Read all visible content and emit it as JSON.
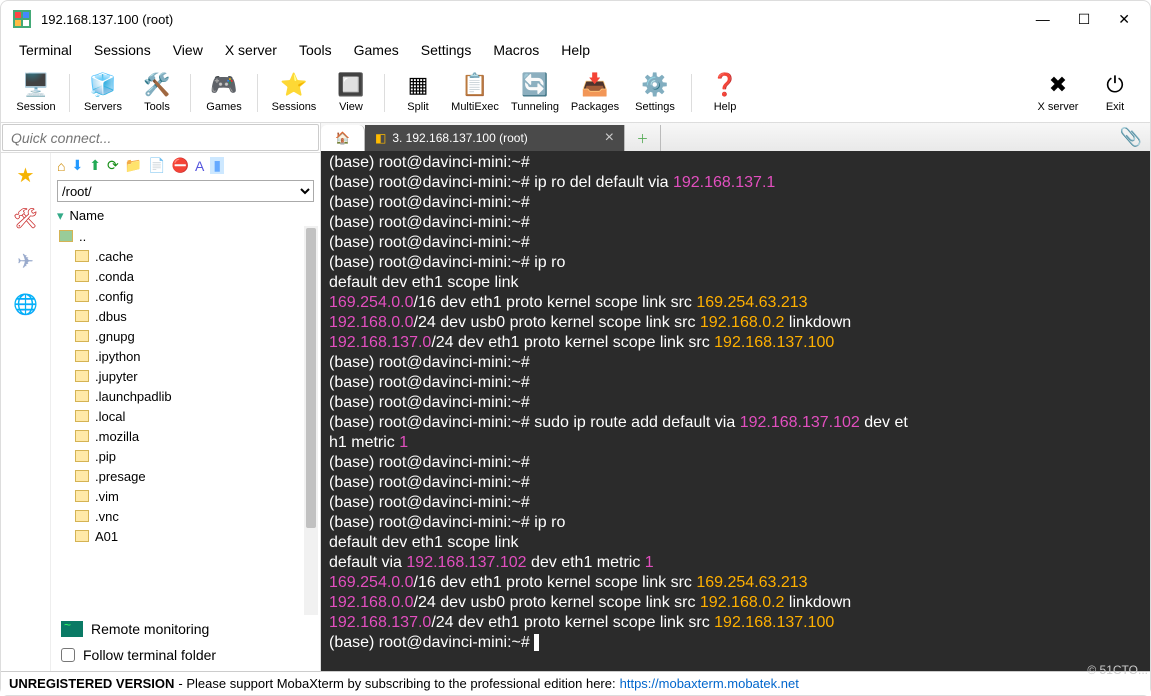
{
  "window": {
    "title": "192.168.137.100 (root)"
  },
  "menu": [
    "Terminal",
    "Sessions",
    "View",
    "X server",
    "Tools",
    "Games",
    "Settings",
    "Macros",
    "Help"
  ],
  "toolbar": [
    {
      "label": "Session",
      "icon": "🖥️"
    },
    {
      "label": "Servers",
      "icon": "🧊"
    },
    {
      "label": "Tools",
      "icon": "🛠️"
    },
    {
      "label": "Games",
      "icon": "🎮"
    },
    {
      "label": "Sessions",
      "icon": "⭐"
    },
    {
      "label": "View",
      "icon": "🔲"
    },
    {
      "label": "Split",
      "icon": "▦"
    },
    {
      "label": "MultiExec",
      "icon": "📋"
    },
    {
      "label": "Tunneling",
      "icon": "🔄"
    },
    {
      "label": "Packages",
      "icon": "📥"
    },
    {
      "label": "Settings",
      "icon": "⚙️"
    },
    {
      "label": "Help",
      "icon": "❓"
    }
  ],
  "toolbar_right": [
    {
      "label": "X server",
      "icon": "✖"
    },
    {
      "label": "Exit",
      "icon": "⏻"
    }
  ],
  "quick_connect_placeholder": "Quick connect...",
  "browser": {
    "path": "/root/",
    "name_header": "Name",
    "parent": "..",
    "folders": [
      ".cache",
      ".conda",
      ".config",
      ".dbus",
      ".gnupg",
      ".ipython",
      ".jupyter",
      ".launchpadlib",
      ".local",
      ".mozilla",
      ".pip",
      ".presage",
      ".vim",
      ".vnc",
      "A01"
    ]
  },
  "remote_monitoring": "Remote monitoring",
  "follow_terminal": "Follow terminal folder",
  "tabs": {
    "active": "3. 192.168.137.100 (root)"
  },
  "term": [
    {
      "t": "p",
      "v": "(base) root@davinci-mini:~# "
    },
    {
      "t": "p",
      "v": "(base) root@davinci-mini:~# ip ro del default via ",
      "tail": {
        "c": "m",
        "v": "192.168.137.1"
      }
    },
    {
      "t": "p",
      "v": "(base) root@davinci-mini:~# "
    },
    {
      "t": "p",
      "v": "(base) root@davinci-mini:~# "
    },
    {
      "t": "p",
      "v": "(base) root@davinci-mini:~# "
    },
    {
      "t": "p",
      "v": "(base) root@davinci-mini:~# ip ro"
    },
    {
      "t": "n",
      "v": "default dev eth1 scope link "
    },
    {
      "t": "mix",
      "parts": [
        {
          "c": "m",
          "v": "169.254.0.0"
        },
        {
          "c": "n",
          "v": "/16 dev eth1 proto kernel scope link src "
        },
        {
          "c": "y",
          "v": "169.254.63.213"
        }
      ]
    },
    {
      "t": "mix",
      "parts": [
        {
          "c": "m",
          "v": "192.168.0.0"
        },
        {
          "c": "n",
          "v": "/24 dev usb0 proto kernel scope link src "
        },
        {
          "c": "y",
          "v": "192.168.0.2"
        },
        {
          "c": "n",
          "v": " linkdown"
        }
      ]
    },
    {
      "t": "mix",
      "parts": [
        {
          "c": "m",
          "v": "192.168.137.0"
        },
        {
          "c": "n",
          "v": "/24 dev eth1 proto kernel scope link src "
        },
        {
          "c": "y",
          "v": "192.168.137.100"
        }
      ]
    },
    {
      "t": "p",
      "v": "(base) root@davinci-mini:~# "
    },
    {
      "t": "p",
      "v": "(base) root@davinci-mini:~# "
    },
    {
      "t": "p",
      "v": "(base) root@davinci-mini:~# "
    },
    {
      "t": "mix",
      "parts": [
        {
          "c": "n",
          "v": "(base) root@davinci-mini:~# sudo ip route add default via "
        },
        {
          "c": "m",
          "v": "192.168.137.102"
        },
        {
          "c": "n",
          "v": " dev et"
        }
      ]
    },
    {
      "t": "mix",
      "parts": [
        {
          "c": "n",
          "v": "h1 metric "
        },
        {
          "c": "m",
          "v": "1"
        }
      ]
    },
    {
      "t": "p",
      "v": "(base) root@davinci-mini:~# "
    },
    {
      "t": "p",
      "v": "(base) root@davinci-mini:~# "
    },
    {
      "t": "p",
      "v": "(base) root@davinci-mini:~# "
    },
    {
      "t": "p",
      "v": "(base) root@davinci-mini:~# ip ro"
    },
    {
      "t": "n",
      "v": "default dev eth1 scope link "
    },
    {
      "t": "mix",
      "parts": [
        {
          "c": "n",
          "v": "default via "
        },
        {
          "c": "m",
          "v": "192.168.137.102"
        },
        {
          "c": "n",
          "v": " dev eth1 metric "
        },
        {
          "c": "m",
          "v": "1"
        }
      ]
    },
    {
      "t": "mix",
      "parts": [
        {
          "c": "m",
          "v": "169.254.0.0"
        },
        {
          "c": "n",
          "v": "/16 dev eth1 proto kernel scope link src "
        },
        {
          "c": "y",
          "v": "169.254.63.213"
        }
      ]
    },
    {
      "t": "mix",
      "parts": [
        {
          "c": "m",
          "v": "192.168.0.0"
        },
        {
          "c": "n",
          "v": "/24 dev usb0 proto kernel scope link src "
        },
        {
          "c": "y",
          "v": "192.168.0.2"
        },
        {
          "c": "n",
          "v": " linkdown"
        }
      ]
    },
    {
      "t": "mix",
      "parts": [
        {
          "c": "m",
          "v": "192.168.137.0"
        },
        {
          "c": "n",
          "v": "/24 dev eth1 proto kernel scope link src "
        },
        {
          "c": "y",
          "v": "192.168.137.100"
        }
      ]
    },
    {
      "t": "cursor",
      "v": "(base) root@davinci-mini:~# "
    }
  ],
  "status": {
    "unreg": "UNREGISTERED VERSION",
    "msg": "   -   Please support MobaXterm by subscribing to the professional edition here:   ",
    "link": "https://mobaxterm.mobatek.net"
  },
  "watermark": "© 51CTO..."
}
